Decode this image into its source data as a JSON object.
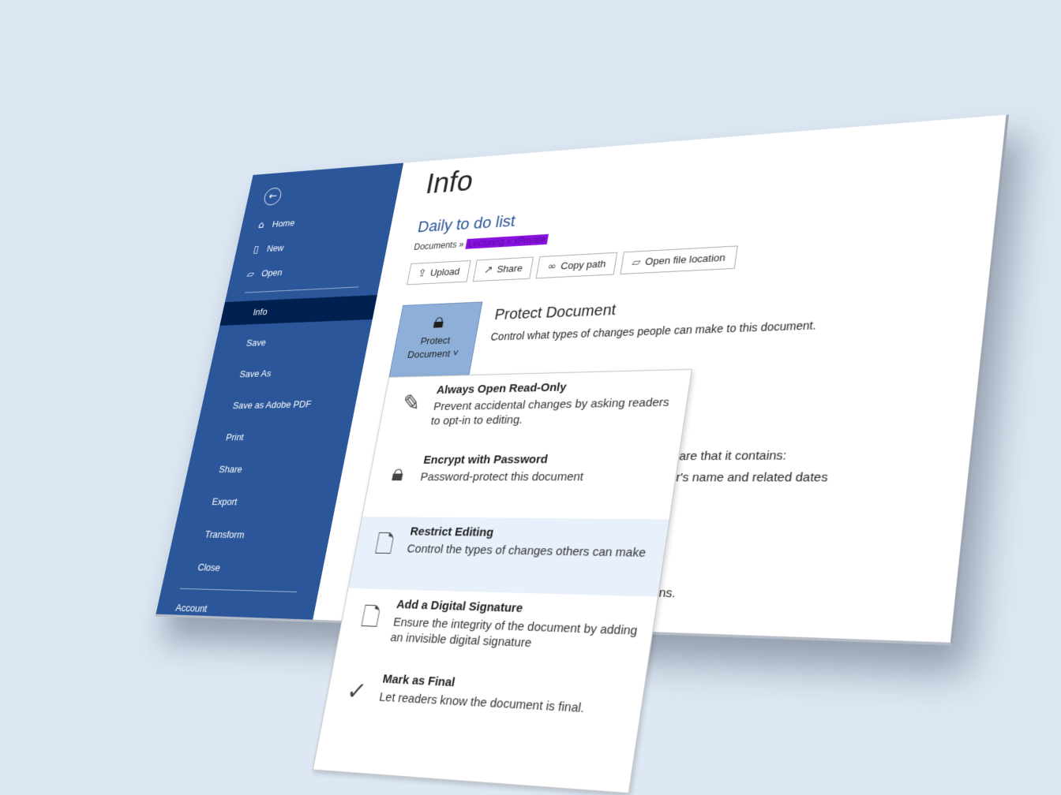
{
  "sidebar": {
    "back_icon": "back-arrow-icon",
    "items": [
      {
        "label": "Home",
        "icon": "home-icon"
      },
      {
        "label": "New",
        "icon": "new-document-icon"
      },
      {
        "label": "Open",
        "icon": "open-folder-icon"
      },
      {
        "label": "Info"
      },
      {
        "label": "Save"
      },
      {
        "label": "Save As"
      },
      {
        "label": "Save as Adobe PDF"
      },
      {
        "label": "Print"
      },
      {
        "label": "Share"
      },
      {
        "label": "Export"
      },
      {
        "label": "Transform"
      },
      {
        "label": "Close"
      },
      {
        "label": "Account"
      }
    ],
    "active": "Info"
  },
  "main": {
    "title": "Info",
    "document_name": "Daily to do list",
    "breadcrumb_prefix": "Documents »",
    "breadcrumb_highlight": "Lecturing » xPrivate",
    "actions": [
      {
        "label": "Upload",
        "icon": "upload-icon"
      },
      {
        "label": "Share",
        "icon": "share-icon"
      },
      {
        "label": "Copy path",
        "icon": "link-icon"
      },
      {
        "label": "Open file location",
        "icon": "folder-icon"
      }
    ],
    "protect": {
      "tile_line1": "Protect",
      "tile_line2": "Document ˅",
      "title": "Protect Document",
      "description": "Control what types of changes people can make to this document."
    },
    "partial_text": {
      "line1": "are that it contains:",
      "line2": "r's name and related dates",
      "line3": "ns."
    }
  },
  "protect_menu": [
    {
      "title": "Always Open Read-Only",
      "description": "Prevent accidental changes by asking readers to opt-in to editing.",
      "icon": "pencil-no-icon"
    },
    {
      "title": "Encrypt with Password",
      "description": "Password-protect this document",
      "icon": "lock-key-icon"
    },
    {
      "title": "Restrict Editing",
      "description": "Control the types of changes others can make",
      "icon": "doc-lock-icon"
    },
    {
      "title": "Add a Digital Signature",
      "description": "Ensure the integrity of the document by adding an invisible digital signature",
      "icon": "doc-ribbon-icon"
    },
    {
      "title": "Mark as Final",
      "description": "Let readers know the document is final.",
      "icon": "doc-check-icon"
    }
  ],
  "colors": {
    "sidebar": "#2b579a",
    "sidebar_active": "#002050",
    "accent": "#2b579a",
    "highlight": "#8a12e0"
  }
}
